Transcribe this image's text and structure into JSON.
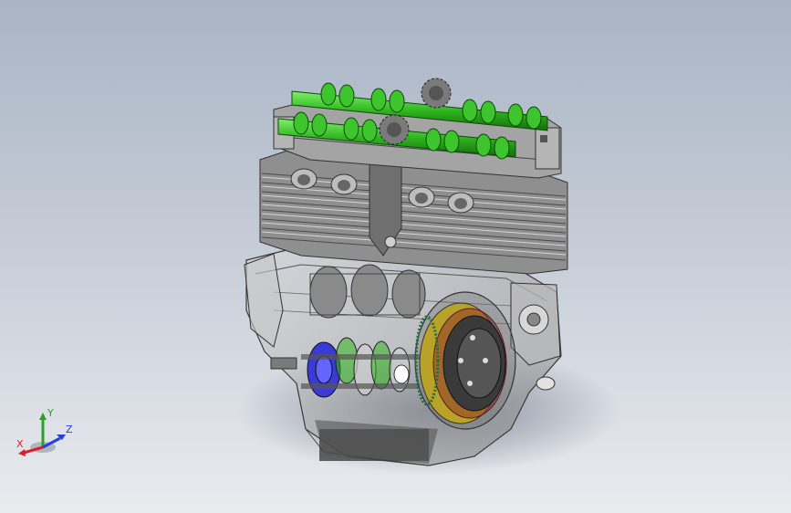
{
  "viewport": {
    "background_top": "#a9b4c4",
    "background_bottom": "#e9ebef"
  },
  "model": {
    "part_colors": {
      "camshaft": "#2fb51e",
      "clutch": "#b8a227",
      "gears": "#3a3ad6",
      "body": "#9a9a9a"
    }
  },
  "triad": {
    "x_label": "X",
    "y_label": "Y",
    "z_label": "Z",
    "colors": {
      "x": "#d8202a",
      "y": "#2aa02a",
      "z": "#2a3fd8"
    }
  }
}
